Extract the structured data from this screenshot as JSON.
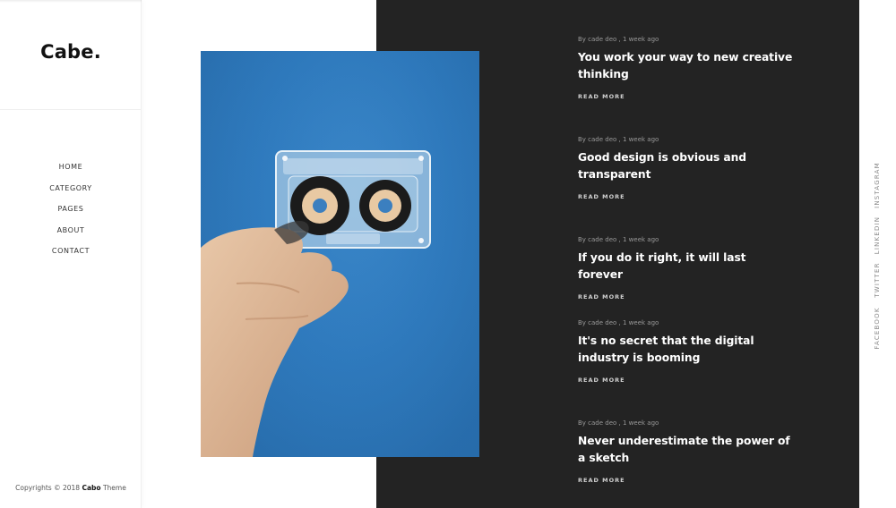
{
  "brand": {
    "logo": "Cabe."
  },
  "nav": {
    "items": [
      {
        "label": "HOME"
      },
      {
        "label": "CATEGORY"
      },
      {
        "label": "PAGES"
      },
      {
        "label": "ABOUT"
      },
      {
        "label": "CONTACT"
      }
    ]
  },
  "footer": {
    "copyright_prefix": "Copyrights © 2018",
    "copyright_brand": "Cabo",
    "copyright_suffix": "Theme"
  },
  "feature": {
    "image_subject": "hand holding a clear cassette tape on blue background"
  },
  "posts": [
    {
      "meta": "By cade deo , 1 week ago",
      "title": "You work your way to new creative thinking",
      "read_more": "READ MORE"
    },
    {
      "meta": "By cade deo , 1 week ago",
      "title": "Good design is obvious and transparent",
      "read_more": "READ MORE"
    },
    {
      "meta": "By cade deo , 1 week ago",
      "title": "If you do it right, it will last forever",
      "read_more": "READ MORE"
    },
    {
      "meta": "By cade deo , 1 week ago",
      "title": "It's no secret that the digital industry is booming",
      "read_more": "READ MORE"
    },
    {
      "meta": "By cade deo , 1 week ago",
      "title": "Never underestimate the power of a sketch",
      "read_more": "READ MORE"
    }
  ],
  "social": {
    "links": [
      {
        "label": "INSTAGRAM"
      },
      {
        "label": "LINKEDIN"
      },
      {
        "label": "TWITTER"
      },
      {
        "label": "FACEBOOK"
      }
    ]
  },
  "colors": {
    "dark_panel": "#232323",
    "feature_blue": "#2f7bbf",
    "text_primary": "#111111",
    "text_on_dark": "#ffffff"
  }
}
